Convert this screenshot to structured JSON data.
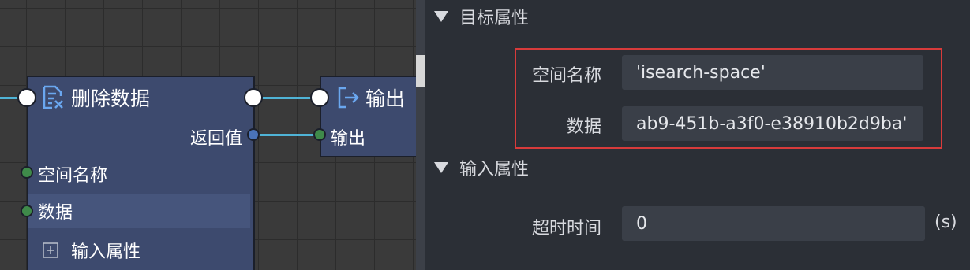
{
  "graph": {
    "delete_node": {
      "title": "删除数据",
      "output_return": "返回值",
      "input_space": "空间名称",
      "input_data": "数据",
      "input_props": "输入属性"
    },
    "output_node": {
      "title": "输出",
      "input_output": "输出"
    },
    "colors": {
      "wire": "#4fb3d6",
      "node_body": "#3d4a6e",
      "icon": "#6aa7f0"
    }
  },
  "panel": {
    "target_section": "目标属性",
    "fields": [
      {
        "label": "空间名称",
        "value": "'isearch-space'"
      },
      {
        "label": "数据",
        "value": "ab9-451b-a3f0-e38910b2d9ba'"
      }
    ],
    "input_section": "输入属性",
    "timeout": {
      "label": "超时时间",
      "value": "0",
      "unit": "(s)"
    },
    "highlight_color": "#d83b3b"
  }
}
